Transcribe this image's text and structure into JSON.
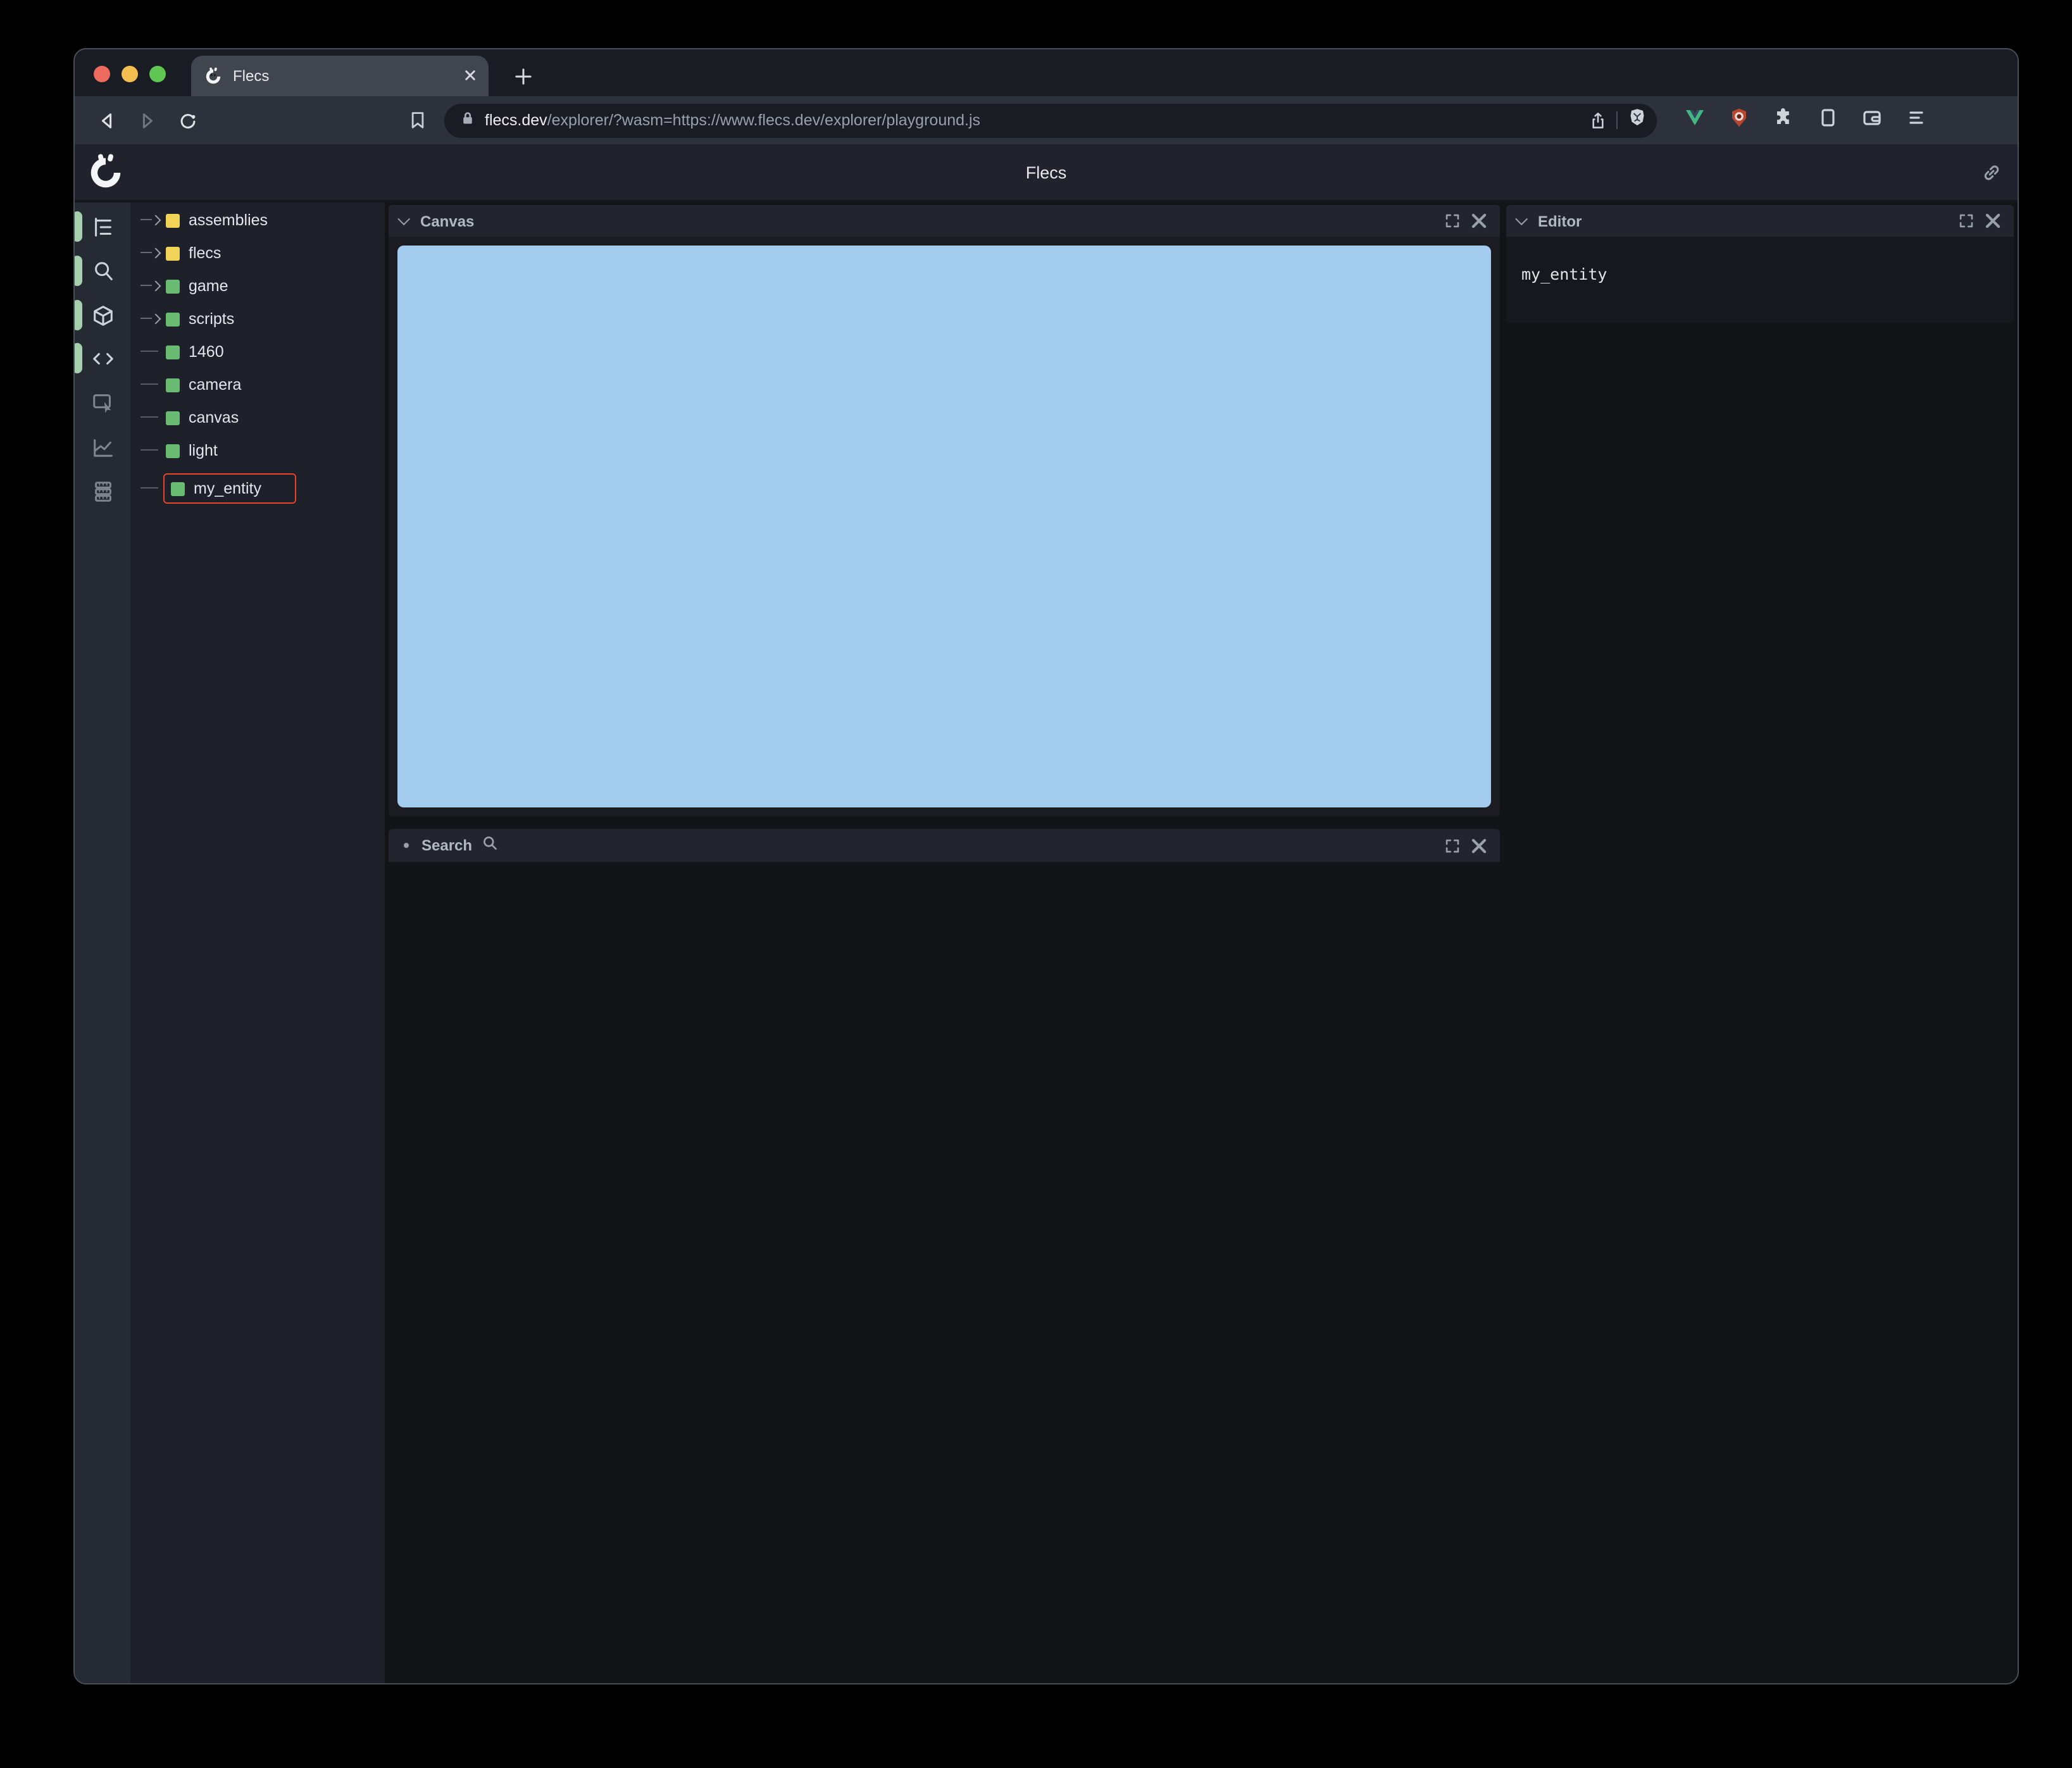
{
  "browser": {
    "tab_title": "Flecs",
    "url_domain": "flecs.dev",
    "url_path": "/explorer/?wasm=https://www.flecs.dev/explorer/playground.js"
  },
  "header": {
    "title": "Flecs"
  },
  "activity_bar": {
    "items": [
      {
        "icon": "tree-hierarchy-icon",
        "active": true
      },
      {
        "icon": "search-icon",
        "active": true
      },
      {
        "icon": "cube-icon",
        "active": true
      },
      {
        "icon": "code-icon",
        "active": true
      },
      {
        "icon": "inspect-icon",
        "active": false
      },
      {
        "icon": "chart-icon",
        "active": false
      },
      {
        "icon": "memory-icon",
        "active": false
      }
    ]
  },
  "tree": {
    "items": [
      {
        "label": "assemblies",
        "color": "yellow",
        "expandable": true
      },
      {
        "label": "flecs",
        "color": "yellow",
        "expandable": true
      },
      {
        "label": "game",
        "color": "green",
        "expandable": true
      },
      {
        "label": "scripts",
        "color": "green",
        "expandable": true
      },
      {
        "label": "1460",
        "color": "green",
        "expandable": false
      },
      {
        "label": "camera",
        "color": "green",
        "expandable": false
      },
      {
        "label": "canvas",
        "color": "green",
        "expandable": false
      },
      {
        "label": "light",
        "color": "green",
        "expandable": false
      },
      {
        "label": "my_entity",
        "color": "green",
        "expandable": false,
        "highlighted": true
      }
    ]
  },
  "panels": {
    "canvas": {
      "title": "Canvas"
    },
    "search": {
      "title": "Search"
    },
    "editor": {
      "title": "Editor",
      "content": "my_entity"
    }
  },
  "colors": {
    "canvas_blue": "#a2cbee",
    "entity_green": "#68bb71",
    "module_yellow": "#f0d357",
    "highlight_red": "#e8432a",
    "active_indicator_green": "#a5cfad",
    "vue_green": "#41b883",
    "shield_ext_red": "#b8452f"
  }
}
